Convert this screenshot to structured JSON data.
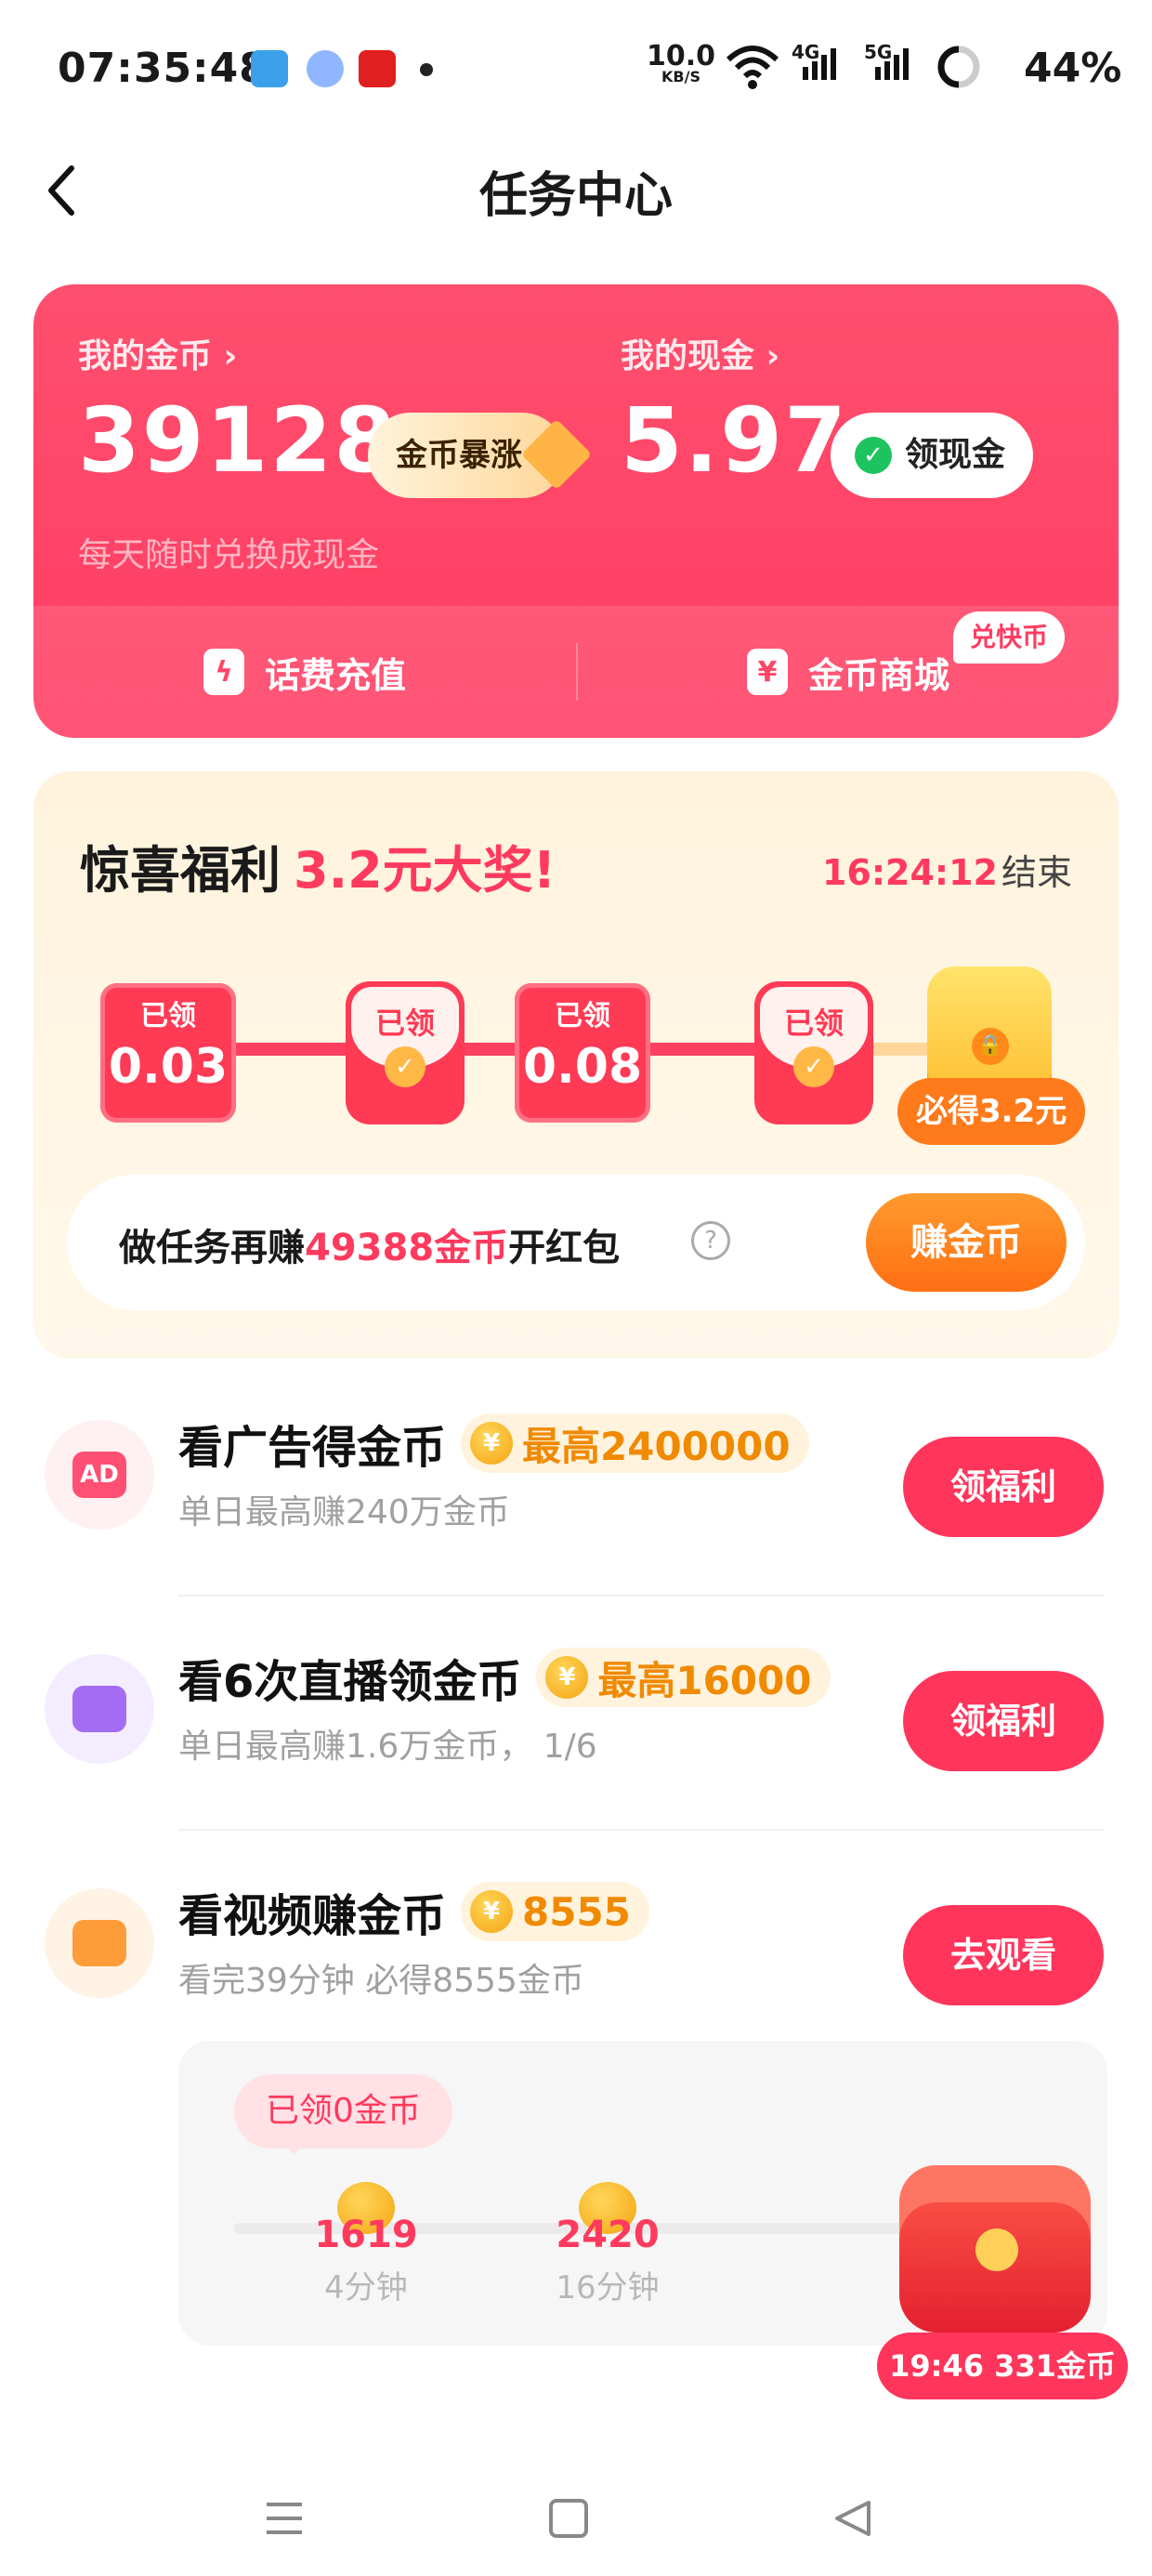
{
  "status_bar": {
    "time": "07:35:48",
    "net_speed": "10.0",
    "net_speed_unit": "KB/S",
    "signal_1": "4G",
    "signal_2": "5G",
    "battery": "44%"
  },
  "header": {
    "title": "任务中心",
    "back_icon": "chevron-left-icon"
  },
  "wallet": {
    "coins_label": "我的金币",
    "coins_value": "39128",
    "surge_label": "金币暴涨",
    "cash_label": "我的现金",
    "cash_value": "5.97",
    "withdraw_label": "领现金",
    "subtitle": "每天随时兑换成现金",
    "recharge_label": "话费充值",
    "mall_label": "金币商城",
    "mall_tag": "兑快币"
  },
  "welfare": {
    "title": "惊喜福利",
    "highlight": "3.2元大奖!",
    "timer": "16:24:12",
    "timer_suffix": "结束",
    "packets": [
      {
        "type": "box",
        "label": "已领",
        "amount": "0.03"
      },
      {
        "type": "envelope",
        "label": "已领"
      },
      {
        "type": "box",
        "label": "已领",
        "amount": "0.08"
      },
      {
        "type": "envelope",
        "label": "已领"
      }
    ],
    "final_tag": "必得3.2元",
    "task_prefix": "做任务再赚",
    "task_amount": "49388金币",
    "task_suffix": "开红包",
    "earn_button": "赚金币"
  },
  "tasks": [
    {
      "title": "看广告得金币",
      "badge": "最高2400000",
      "subtitle": "单日最高赚240万金币",
      "button": "领福利",
      "icon": "ad-icon",
      "color": "#ff4f73"
    },
    {
      "title": "看6次直播领金币",
      "badge": "最高16000",
      "subtitle": "单日最高赚1.6万金币， 1/6",
      "button": "领福利",
      "icon": "live-camera-icon",
      "color": "#a46cf2"
    },
    {
      "title": "看视频赚金币",
      "badge": "8555",
      "subtitle": "看完39分钟 必得8555金币",
      "button": "去观看",
      "icon": "video-camera-icon",
      "color": "#ff9c3a"
    }
  ],
  "video_progress": {
    "received": "已领0金币",
    "milestones": [
      {
        "coins": "1619",
        "time": "4分钟"
      },
      {
        "coins": "2420",
        "time": "16分钟"
      }
    ],
    "chest_tag": "19:46 331金币"
  }
}
